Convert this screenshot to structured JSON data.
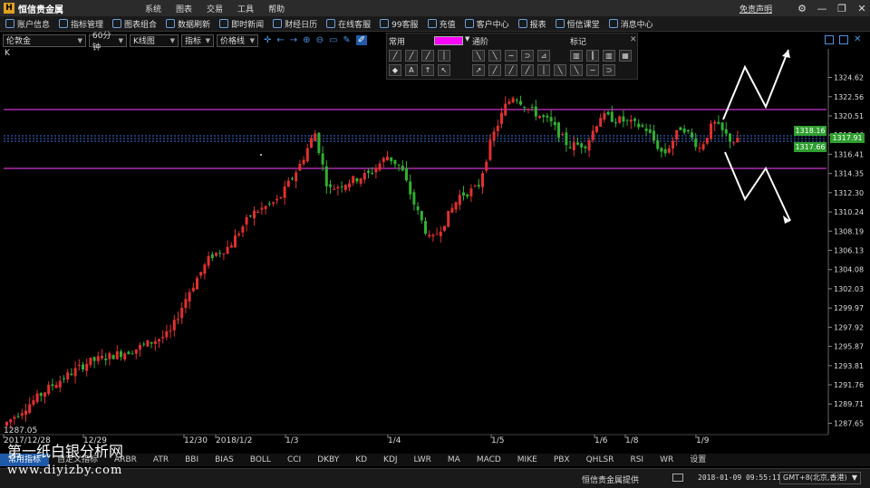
{
  "titlebar": {
    "app_title": "恒信贵金属",
    "menu": [
      "系统",
      "图表",
      "交易",
      "工具",
      "帮助"
    ],
    "disclaimer": "免责声明"
  },
  "toolbar": {
    "items": [
      "账户信息",
      "指标管理",
      "图表组合",
      "数据刷新",
      "即时新闻",
      "财经日历",
      "在线客服",
      "99客服",
      "充值",
      "客户中心",
      "报表",
      "恒信课堂",
      "消息中心"
    ]
  },
  "controls": {
    "symbol": "伦敦金",
    "period": "60分钟",
    "chart_type": "K线图",
    "indicator": "指标",
    "line_type": "价格线"
  },
  "draw_panel": {
    "common": "常用",
    "retrace": "通阶",
    "mark": "标记"
  },
  "chart_label": "K",
  "price_axis": [
    "1324.62",
    "1322.56",
    "1320.51",
    "1318.46",
    "1316.41",
    "1314.35",
    "1312.30",
    "1310.24",
    "1308.19",
    "1306.13",
    "1304.08",
    "1302.03",
    "1299.97",
    "1297.92",
    "1295.87",
    "1293.81",
    "1291.76",
    "1289.71",
    "1287.65"
  ],
  "price_tags": {
    "top": "1318.16",
    "mid": "1317.91",
    "low": "1317.66"
  },
  "low_label": "1287.05",
  "dates": [
    "2017/12/28",
    "12/29",
    "12/30",
    "2018/1/2",
    "1/3",
    "1/4",
    "1/5",
    "1/6",
    "1/8",
    "1/9"
  ],
  "bottom_tabs": [
    "常用指标",
    "自定义指标",
    "ARBR",
    "ATR",
    "BBI",
    "BIAS",
    "BOLL",
    "CCI",
    "DKBY",
    "KD",
    "KDJ",
    "LWR",
    "MA",
    "MACD",
    "MIKE",
    "PBX",
    "QHLSR",
    "RSI",
    "WR",
    "设置"
  ],
  "status": {
    "source": "恒信贵金属提供",
    "time": "2018-01-09 09:55:11",
    "timezone": "GMT+8(北京,香港)"
  },
  "watermark": {
    "line1": "第一纸白银分析网",
    "line2": "www.diyizby.com"
  },
  "colors": {
    "up": "#e03030",
    "down": "#30b030",
    "hline": "#cc33cc",
    "tag_green": "#2e9e2e"
  }
}
